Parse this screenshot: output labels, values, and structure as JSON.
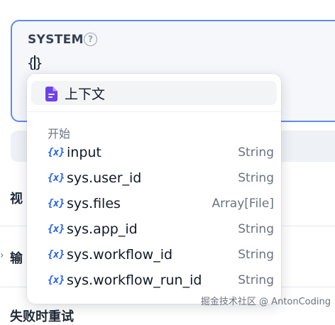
{
  "system_panel": {
    "title": "SYSTEM",
    "help": "?",
    "editor_text": "{}"
  },
  "background": {
    "label_1": "视",
    "label_2": "输",
    "label_3": "失败时重试"
  },
  "popup": {
    "context": {
      "label": "上下文",
      "icon": "document-icon",
      "icon_color": "#6d42e6"
    },
    "section": "开始",
    "var_icon_glyph": "{x}",
    "var_icon_color": "#2563eb",
    "variables": [
      {
        "name": "input",
        "type": "String"
      },
      {
        "name": "sys.user_id",
        "type": "String"
      },
      {
        "name": "sys.files",
        "type": "Array[File]"
      },
      {
        "name": "sys.app_id",
        "type": "String"
      },
      {
        "name": "sys.workflow_id",
        "type": "String"
      },
      {
        "name": "sys.workflow_run_id",
        "type": "String"
      }
    ]
  },
  "watermark": "掘金技术社区 @ AntonCoding",
  "colors": {
    "focus_border": "#5b8def",
    "accent_blue": "#2563eb"
  }
}
